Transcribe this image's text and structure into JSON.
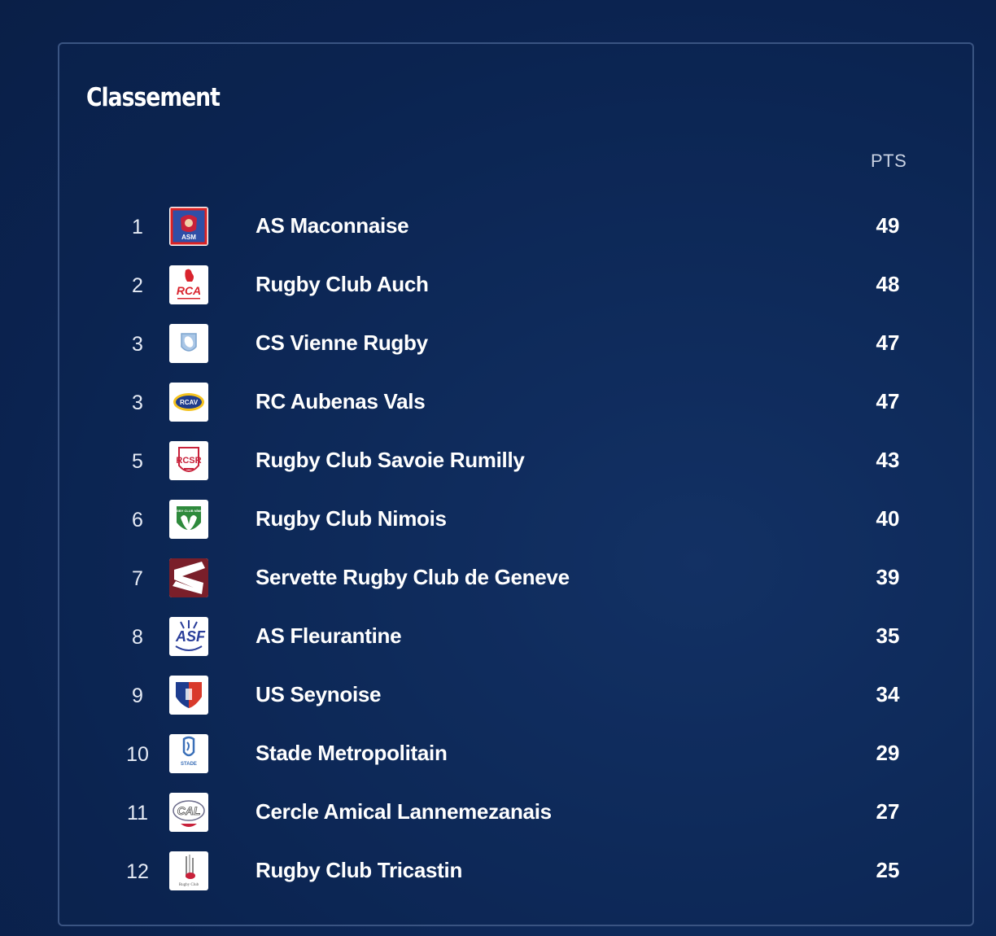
{
  "standings": {
    "title": "Classement",
    "pts_header": "PTS",
    "rows": [
      {
        "rank": "1",
        "team": "AS Maconnaise",
        "pts": "49",
        "logo_icon": "asm-crest-icon",
        "logo_text": "ASM"
      },
      {
        "rank": "2",
        "team": "Rugby Club Auch",
        "pts": "48",
        "logo_icon": "rca-crest-icon",
        "logo_text": "RCA"
      },
      {
        "rank": "3",
        "team": "CS Vienne Rugby",
        "pts": "47",
        "logo_icon": "cs-vienne-crest-icon",
        "logo_text": ""
      },
      {
        "rank": "3",
        "team": "RC Aubenas Vals",
        "pts": "47",
        "logo_icon": "rcav-crest-icon",
        "logo_text": "RCAV"
      },
      {
        "rank": "5",
        "team": "Rugby Club Savoie Rumilly",
        "pts": "43",
        "logo_icon": "rcsr-crest-icon",
        "logo_text": "RCSR"
      },
      {
        "rank": "6",
        "team": "Rugby Club Nimois",
        "pts": "40",
        "logo_icon": "nimois-crest-icon",
        "logo_text": "RUGBY CLUB NÎMOIS"
      },
      {
        "rank": "7",
        "team": "Servette Rugby Club de Geneve",
        "pts": "39",
        "logo_icon": "servette-crest-icon",
        "logo_text": ""
      },
      {
        "rank": "8",
        "team": "AS Fleurantine",
        "pts": "35",
        "logo_icon": "asf-crest-icon",
        "logo_text": "ASF"
      },
      {
        "rank": "9",
        "team": "US Seynoise",
        "pts": "34",
        "logo_icon": "seynoise-crest-icon",
        "logo_text": ""
      },
      {
        "rank": "10",
        "team": "Stade Metropolitain",
        "pts": "29",
        "logo_icon": "stade-metro-crest-icon",
        "logo_text": "STADE"
      },
      {
        "rank": "11",
        "team": "Cercle Amical Lannemezanais",
        "pts": "27",
        "logo_icon": "cal-crest-icon",
        "logo_text": "CAL"
      },
      {
        "rank": "12",
        "team": "Rugby Club Tricastin",
        "pts": "25",
        "logo_icon": "tricastin-crest-icon",
        "logo_text": "Rugby Club"
      }
    ]
  },
  "colors": {
    "background": "#0b2350",
    "card_border": "#3a5482",
    "text": "#ffffff",
    "muted_text": "#c9d2e3"
  }
}
